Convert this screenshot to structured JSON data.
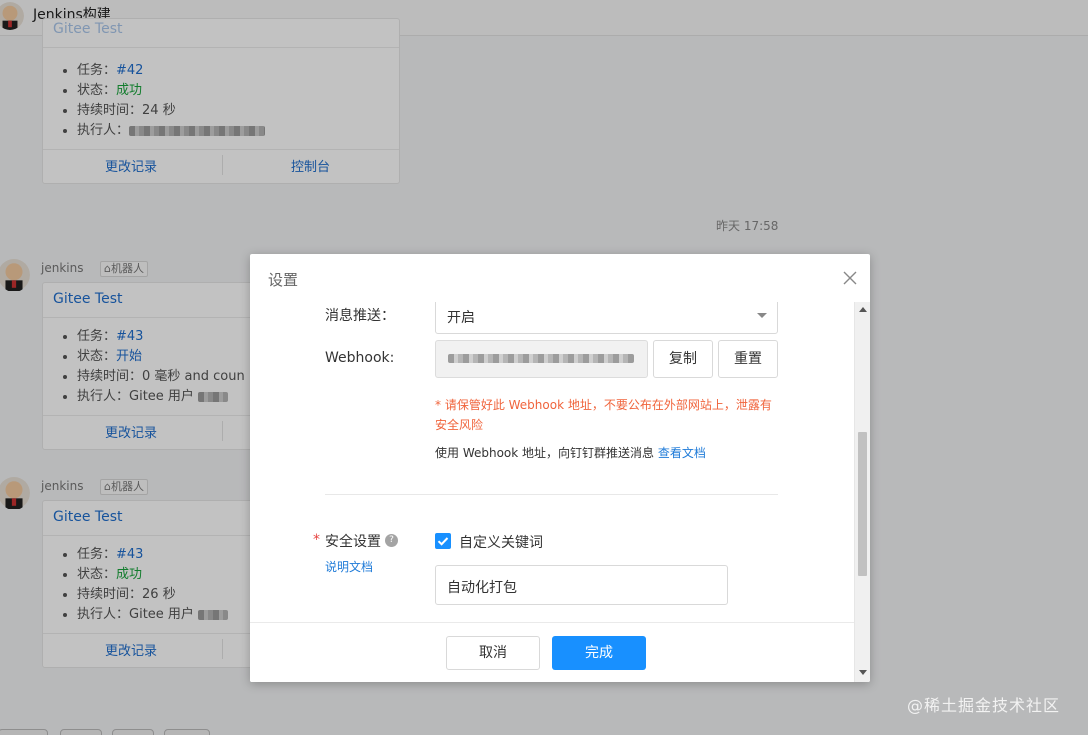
{
  "window": {
    "title": "Jenkins构建"
  },
  "chat": {
    "top_card": {
      "items": [
        {
          "label": "任务：",
          "value": "#42"
        },
        {
          "label": "状态：",
          "value": "成功"
        },
        {
          "label": "持续时间：",
          "value": "24 秒"
        },
        {
          "label": "执行人：",
          "value": ""
        }
      ],
      "footer_left": "更改记录",
      "footer_right": "控制台"
    },
    "timestamp": "昨天 17:58",
    "messages": [
      {
        "sender": "jenkins",
        "tag": "机器人",
        "card_title": "Gitee Test",
        "items": [
          {
            "label": "任务：",
            "value": "#43"
          },
          {
            "label": "状态：",
            "value": "开始"
          },
          {
            "label": "持续时间：",
            "value": "0 毫秒 and coun"
          },
          {
            "label": "执行人：",
            "value": "Gitee 用户"
          }
        ],
        "footer_left": "更改记录"
      },
      {
        "sender": "jenkins",
        "tag": "机器人",
        "card_title": "Gitee Test",
        "items": [
          {
            "label": "任务：",
            "value": "#43"
          },
          {
            "label": "状态：",
            "value": "成功"
          },
          {
            "label": "持续时间：",
            "value": "26 秒"
          },
          {
            "label": "执行人：",
            "value": "Gitee 用户"
          }
        ],
        "footer_left": "更改记录"
      }
    ]
  },
  "modal": {
    "title": "设置",
    "push": {
      "label": "消息推送：",
      "value": "开启"
    },
    "webhook": {
      "label": "Webhook:",
      "copy": "复制",
      "reset": "重置"
    },
    "warning": "* 请保管好此 Webhook 地址，不要公布在外部网站上，泄露有安全风险",
    "hint": "使用 Webhook 地址，向钉钉群推送消息",
    "hint_link": "查看文档",
    "security": {
      "required_mark": "*",
      "label": "安全设置",
      "help_glyph": "?",
      "doc_link": "说明文档",
      "option": "自定义关键词",
      "keyword": "自动化打包"
    },
    "footer": {
      "cancel": "取消",
      "confirm": "完成"
    }
  },
  "watermark": "@稀土掘金技术社区",
  "colors": {
    "accent": "#1890ff",
    "success": "#1aa53d",
    "warning": "#f0643c",
    "link": "#1f6ecd"
  }
}
